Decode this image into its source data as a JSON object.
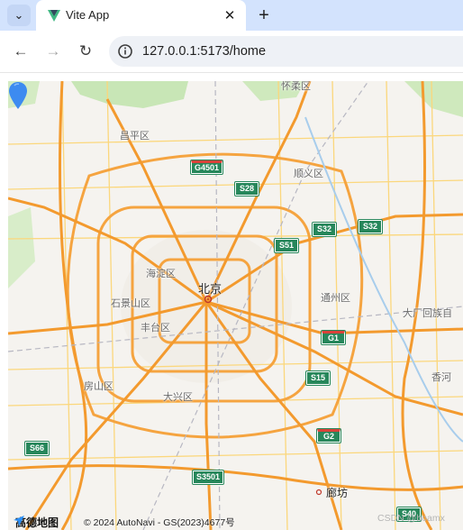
{
  "browser": {
    "tab_title": "Vite App",
    "url": "127.0.0.1:5173/home"
  },
  "map": {
    "labels": {
      "huairou": "怀柔区",
      "changping": "昌平区",
      "shunyi": "顺义区",
      "haidian": "海淀区",
      "beijing": "北京",
      "shijingshan": "石景山区",
      "tongzhou": "通州区",
      "dachang": "大厂回族自",
      "fengtai": "丰台区",
      "sanhe": "香河",
      "fangshan": "房山区",
      "daxing": "大兴区",
      "langfang": "廊坊"
    },
    "shields": {
      "g4501": "G4501",
      "s28": "S28",
      "s32a": "S32",
      "s32b": "S32",
      "s51": "S51",
      "g1": "G1",
      "s15": "S15",
      "g2": "G2",
      "s66": "S66",
      "s3501": "S3501",
      "s40": "S40"
    },
    "logo_text": "高德地图",
    "copyright": "© 2024 AutoNavi - GS(2023)4677号",
    "watermark": "CSDN @boamx"
  }
}
